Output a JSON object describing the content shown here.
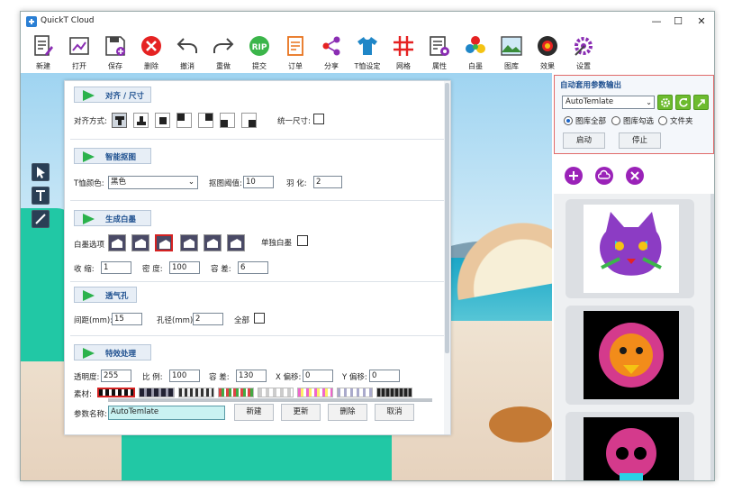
{
  "window": {
    "title": "QuickT Cloud"
  },
  "toolbar": [
    {
      "id": "new",
      "label": "新建",
      "icon": "new-doc-icon"
    },
    {
      "id": "open",
      "label": "打开",
      "icon": "open-folder-icon"
    },
    {
      "id": "save",
      "label": "保存",
      "icon": "save-icon"
    },
    {
      "id": "delete",
      "label": "删除",
      "icon": "delete-icon"
    },
    {
      "id": "undo",
      "label": "撤消",
      "icon": "undo-icon"
    },
    {
      "id": "redo",
      "label": "重做",
      "icon": "redo-icon"
    },
    {
      "id": "submit",
      "label": "提交",
      "icon": "rip-icon"
    },
    {
      "id": "order",
      "label": "订单",
      "icon": "order-icon"
    },
    {
      "id": "share",
      "label": "分享",
      "icon": "share-icon"
    },
    {
      "id": "tshirt",
      "label": "T恤设定",
      "icon": "tshirt-icon"
    },
    {
      "id": "grid",
      "label": "网格",
      "icon": "grid-icon"
    },
    {
      "id": "props",
      "label": "属性",
      "icon": "properties-icon"
    },
    {
      "id": "white",
      "label": "白墨",
      "icon": "white-ink-icon"
    },
    {
      "id": "gallery",
      "label": "图库",
      "icon": "gallery-icon"
    },
    {
      "id": "effect",
      "label": "效果",
      "icon": "effects-icon"
    },
    {
      "id": "settings",
      "label": "设置",
      "icon": "settings-icon"
    }
  ],
  "rip_text": "RIP",
  "panel": {
    "align": {
      "header": "对齐 / 尺寸",
      "label": "对齐方式:",
      "uniform_size": "统一尺寸:"
    },
    "smart": {
      "header": "智能抠图",
      "tshirt_color_label": "T恤颜色:",
      "tshirt_color": "黑色",
      "threshold_label": "抠图阈值:",
      "threshold": "10",
      "feather_label": "羽   化:",
      "feather": "2"
    },
    "white": {
      "header": "生成白墨",
      "options_label": "白墨选项",
      "single_label": "单独白墨",
      "shrink_label": "收   缩:",
      "shrink": "1",
      "density_label": "密   度:",
      "density": "100",
      "tolerance_label": "容   差:",
      "tolerance": "6"
    },
    "vent": {
      "header": "透气孔",
      "spacing_label": "间距(mm):",
      "spacing": "15",
      "hole_label": "孔径(mm):",
      "hole": "2",
      "all_label": "全部"
    },
    "effects": {
      "header": "特效处理",
      "opacity_label": "透明度:",
      "opacity": "255",
      "scale_label": "比   例:",
      "scale": "100",
      "tolerance_label": "容   差:",
      "tolerance": "130",
      "xoff_label": "X 偏移:",
      "xoff": "0",
      "yoff_label": "Y 偏移:",
      "yoff": "0",
      "material_label": "素材:"
    },
    "param_name_label": "参数名称:",
    "param_name": "AutoTemlate",
    "buttons": {
      "new": "新建",
      "update": "更新",
      "delete": "删除",
      "cancel": "取消"
    }
  },
  "auto_output": {
    "title": "自动套用参数输出",
    "preset": "AutoTemlate",
    "radio_all": "图库全部",
    "radio_checked": "图库勾选",
    "radio_folder": "文件夹",
    "start": "启动",
    "stop": "停止"
  },
  "colors": {
    "accent": "#9a22b8",
    "green": "#6dbb2f",
    "header_text": "#1d4f8f",
    "shirt": "#21c8a5"
  }
}
